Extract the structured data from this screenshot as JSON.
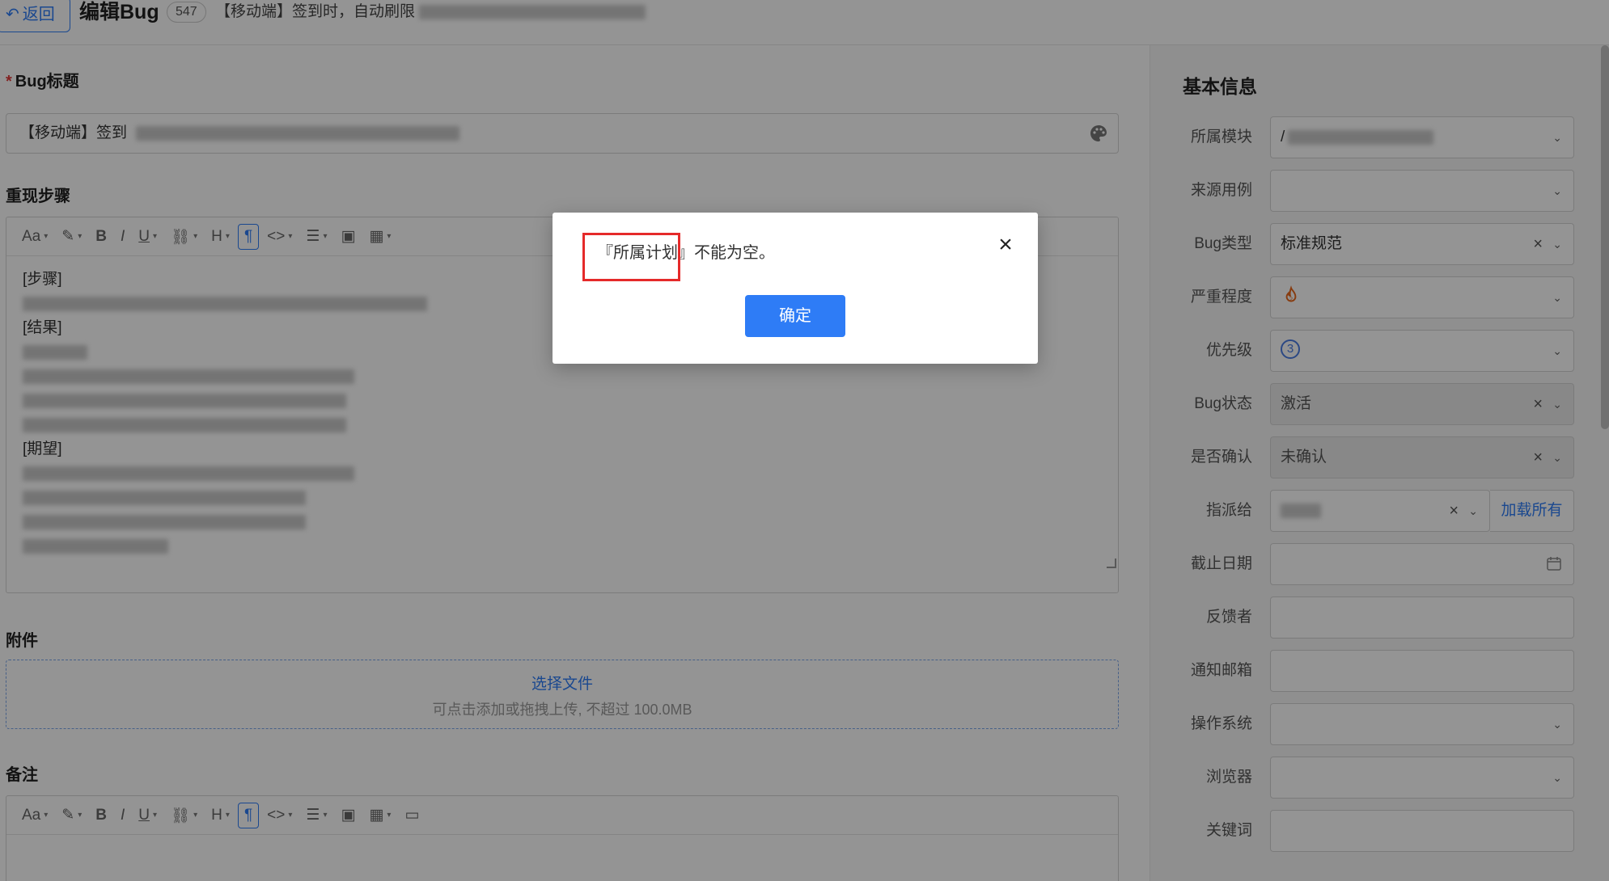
{
  "header": {
    "back_label": "返回",
    "title": "编辑Bug",
    "bug_id": "547",
    "summary_prefix": "【移动端】签到时，自动刷限"
  },
  "main": {
    "title_label": "Bug标题",
    "title_value": "【移动端】签到",
    "steps_label": "重现步骤",
    "steps_lines": [
      "[步骤]",
      "",
      "[结果]",
      "",
      "",
      "",
      "",
      "[期望]"
    ],
    "attachments_label": "附件",
    "upload_pick": "选择文件",
    "upload_hint": "可点击添加或拖拽上传, 不超过 100.0MB",
    "notes_label": "备注"
  },
  "sidebar": {
    "title": "基本信息",
    "fields": [
      {
        "label": "所属模块",
        "value": "/"
      },
      {
        "label": "来源用例",
        "value": ""
      },
      {
        "label": "Bug类型",
        "value": "标准规范"
      },
      {
        "label": "严重程度",
        "value": ""
      },
      {
        "label": "优先级",
        "value": "3"
      },
      {
        "label": "Bug状态",
        "value": "激活"
      },
      {
        "label": "是否确认",
        "value": "未确认"
      },
      {
        "label": "指派给",
        "value": ""
      },
      {
        "label": "截止日期",
        "value": ""
      },
      {
        "label": "反馈者",
        "value": ""
      },
      {
        "label": "通知邮箱",
        "value": ""
      },
      {
        "label": "操作系统",
        "value": ""
      },
      {
        "label": "浏览器",
        "value": ""
      },
      {
        "label": "关键词",
        "value": ""
      }
    ],
    "load_all_label": "加载所有"
  },
  "toolbar": {
    "items": [
      "Aa",
      "B",
      "I",
      "U",
      "H",
      "¶",
      "<>"
    ]
  },
  "modal": {
    "field_name": "『所属计划』",
    "message_rest": "不能为空。",
    "ok_label": "确定",
    "close_glyph": "×"
  },
  "colors": {
    "accent": "#2e7cf6",
    "highlight": "#e52a2a"
  }
}
